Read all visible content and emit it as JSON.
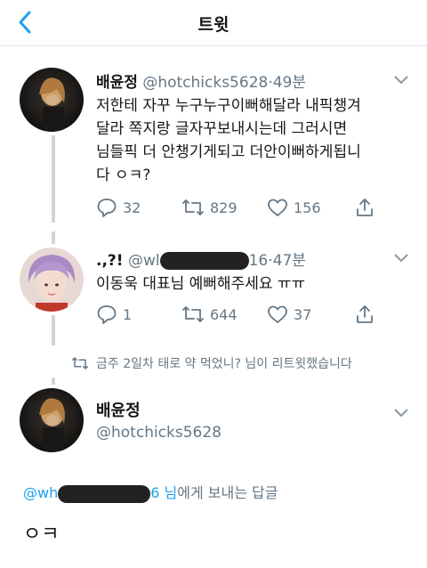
{
  "topbar": {
    "title": "트윗"
  },
  "tweets": [
    {
      "name": "배윤정",
      "handle": "@hotchicks5628",
      "dot": "·",
      "time": "49분",
      "text_lines": [
        "저한테 자꾸 누구누구이뻐해달라 내픽챙겨",
        "달라 쪽지랑 글자꾸보내시는데  그러시면",
        "님들픽 더 안챙기게되고 더안이뻐하게됩니",
        "다 ㅇㅋ?"
      ],
      "replies": "32",
      "retweets": "829",
      "likes": "156"
    },
    {
      "name": ".,?!",
      "handle_start": "@wl",
      "handle_end": "16",
      "dot": "·",
      "time": "47분",
      "text": "이동욱 대표님 예뻐해주세요 ㅠㅠ",
      "replies": "1",
      "retweets": "644",
      "likes": "37"
    }
  ],
  "retweet_note": "금주 2일차 태로 약 먹었니? 님이 리트윗했습니다",
  "main_tweet": {
    "name": "배윤정",
    "handle": "@hotchicks5628",
    "reply_prefix": "@wh",
    "reply_mid": "6 님",
    "reply_suffix": "에게 보내는 답글",
    "text": "ㅇㅋ"
  },
  "colors": {
    "accent": "#1da1f2",
    "muted": "#657786",
    "text": "#14171a",
    "divider": "#e1e8ed"
  },
  "icons": [
    "back-chevron-icon",
    "chevron-down-icon",
    "reply-icon",
    "retweet-icon",
    "like-icon",
    "share-icon"
  ]
}
